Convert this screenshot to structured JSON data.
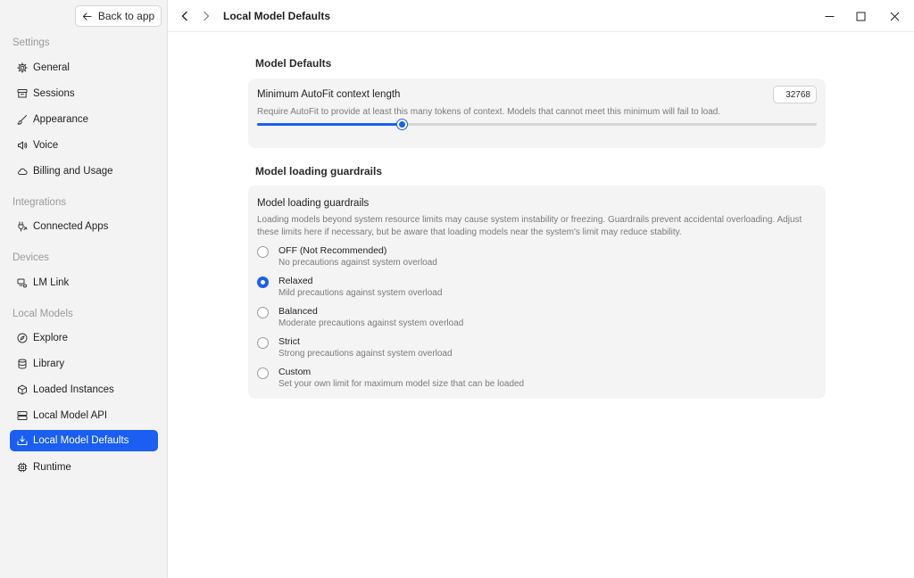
{
  "sidebar": {
    "back_label": "Back to app",
    "sections": {
      "settings": "Settings",
      "integrations": "Integrations",
      "devices": "Devices",
      "local_models": "Local Models"
    },
    "items": {
      "general": "General",
      "sessions": "Sessions",
      "appearance": "Appearance",
      "voice": "Voice",
      "billing": "Billing and Usage",
      "connected_apps": "Connected Apps",
      "lm_link": "LM Link",
      "explore": "Explore",
      "library": "Library",
      "loaded_instances": "Loaded Instances",
      "local_model_api": "Local Model API",
      "local_model_defaults": "Local Model Defaults",
      "runtime": "Runtime"
    },
    "active_item": "local_model_defaults"
  },
  "header": {
    "title": "Local Model Defaults"
  },
  "model_defaults": {
    "heading": "Model Defaults",
    "autofit": {
      "title": "Minimum AutoFit context length",
      "description": "Require AutoFit to provide at least this many tokens of context. Models that cannot meet this minimum will fail to load.",
      "value": "32768",
      "slider_fraction": 0.259
    }
  },
  "guardrails": {
    "heading": "Model loading guardrails",
    "card_title": "Model loading guardrails",
    "description_line1": "Loading models beyond system resource limits may cause system instability or freezing. Guardrails prevent accidental overloading. Adjust",
    "description_line2": "these limits here if necessary, but be aware that loading models near the system's limit may reduce stability.",
    "options": [
      {
        "label": "OFF (Not Recommended)",
        "sub": "No precautions against system overload",
        "checked": false
      },
      {
        "label": "Relaxed",
        "sub": "Mild precautions against system overload",
        "checked": true
      },
      {
        "label": "Balanced",
        "sub": "Moderate precautions against system overload",
        "checked": false
      },
      {
        "label": "Strict",
        "sub": "Strong precautions against system overload",
        "checked": false
      },
      {
        "label": "Custom",
        "sub": "Set your own limit for maximum model size that can be loaded",
        "checked": false
      }
    ]
  },
  "colors": {
    "accent": "#1a5ff1",
    "sidebar_bg": "#f3f3f3",
    "card_bg": "#f4f4f4"
  }
}
